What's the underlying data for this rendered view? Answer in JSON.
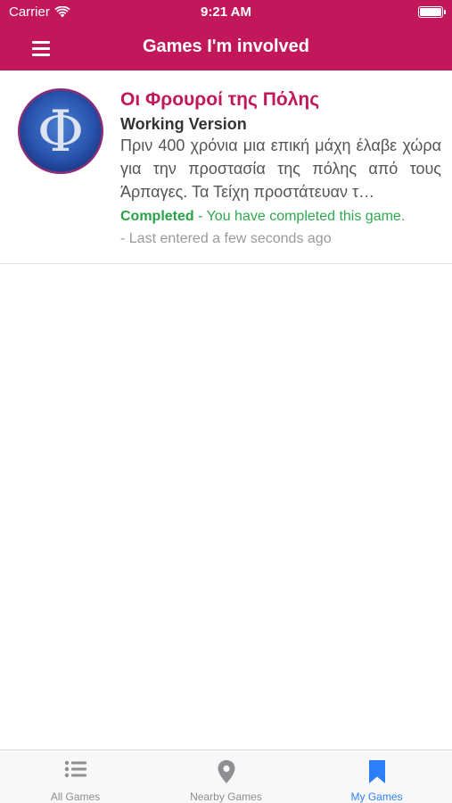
{
  "status_bar": {
    "carrier": "Carrier",
    "time": "9:21 AM"
  },
  "nav": {
    "title": "Games I'm involved"
  },
  "games": [
    {
      "logo_glyph": "Φ",
      "title": "Οι Φρουροί της Πόλης",
      "version": "Working Version",
      "description": "Πριν 400 χρόνια μια επική μάχη έλαβε χώρα για την προστασία της πόλης από τους Άρπαγες. Τα Τείχη προστάτευαν τ…",
      "status_label": "Completed",
      "status_detail": " - You have completed this game.",
      "last_entered": "- Last entered a few seconds ago"
    }
  ],
  "tabs": [
    {
      "label": "All Games",
      "icon": "list-icon",
      "active": false
    },
    {
      "label": "Nearby Games",
      "icon": "map-pin-icon",
      "active": false
    },
    {
      "label": "My Games",
      "icon": "bookmark-icon",
      "active": true
    }
  ],
  "colors": {
    "brand": "#c2185b",
    "completed": "#27a244",
    "tab_active": "#2d7ff9",
    "tab_inactive": "#8e8e93"
  }
}
